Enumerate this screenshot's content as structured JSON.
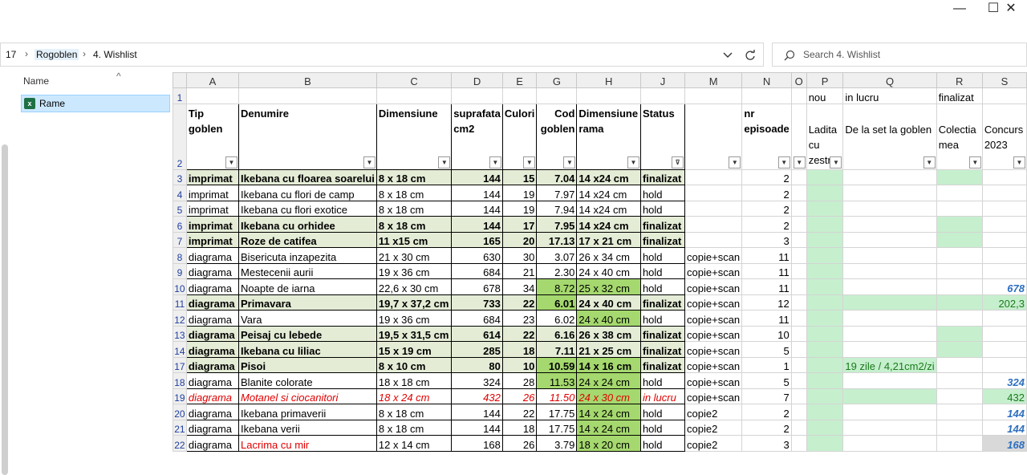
{
  "titlebar": {
    "minimize": "—",
    "maximize": "☐",
    "close": "✕"
  },
  "address": {
    "prev_fragment": "17",
    "crumbs": [
      "Rogoblen",
      "4. Wishlist"
    ],
    "separator": "›",
    "dropdown_icon": "chevron-down",
    "refresh_icon": "refresh"
  },
  "search": {
    "placeholder": "Search 4. Wishlist"
  },
  "nav": {
    "column_label": "Name",
    "sort_glyph": "^",
    "item": "Rame"
  },
  "columns": [
    "A",
    "B",
    "C",
    "D",
    "E",
    "G",
    "H",
    "J",
    "M",
    "N",
    "O",
    "P",
    "Q",
    "R",
    "S"
  ],
  "row1": {
    "P": "nou",
    "Q": "in lucru",
    "R": "finalizat"
  },
  "headers": {
    "A": "Tip goblen",
    "B": "Denumire",
    "C": "Dimensiune",
    "D": "suprafata cm2",
    "E": "Culori",
    "G": "Cod goblen",
    "H": "Dimensiune rama",
    "J": "Status",
    "M": "",
    "N": "nr episoade",
    "O": "",
    "P": "Ladita cu zestre",
    "Q": "De la set la goblen",
    "R": "Colectia mea",
    "S": "Concurs 2023"
  },
  "rows": [
    {
      "n": "3",
      "A": "imprimat",
      "B": "Ikebana cu floarea soarelui",
      "C": "8 x 18 cm",
      "D": "144",
      "E": "15",
      "G": "7.04",
      "H": "14 x24 cm",
      "J": "finalizat",
      "M": "",
      "N": "2",
      "P": "",
      "Q": "",
      "R": "",
      "S": ""
    },
    {
      "n": "4",
      "A": "imprimat",
      "B": "Ikebana cu flori de camp",
      "C": "8 x 18 cm",
      "D": "144",
      "E": "19",
      "G": "7.97",
      "H": "14 x24 cm",
      "J": "hold",
      "M": "",
      "N": "2",
      "P": "",
      "Q": "",
      "R": "",
      "S": ""
    },
    {
      "n": "5",
      "A": "imprimat",
      "B": "Ikebana cu flori exotice",
      "C": "8 x 18 cm",
      "D": "144",
      "E": "19",
      "G": "7.94",
      "H": "14 x24 cm",
      "J": "hold",
      "M": "",
      "N": "2",
      "P": "",
      "Q": "",
      "R": "",
      "S": ""
    },
    {
      "n": "6",
      "A": "imprimat",
      "B": "Ikebana cu orhidee",
      "C": "8 x 18 cm",
      "D": "144",
      "E": "17",
      "G": "7.95",
      "H": "14 x24 cm",
      "J": "finalizat",
      "M": "",
      "N": "2",
      "P": "",
      "Q": "",
      "R": "",
      "S": ""
    },
    {
      "n": "7",
      "A": "imprimat",
      "B": "Roze de catifea",
      "C": "11 x15 cm",
      "D": "165",
      "E": "20",
      "G": "17.13",
      "H": "17 x 21 cm",
      "J": "finalizat",
      "M": "",
      "N": "3",
      "P": "",
      "Q": "",
      "R": "",
      "S": ""
    },
    {
      "n": "8",
      "A": "diagrama",
      "B": "Bisericuta inzapezita",
      "C": "21 x 30 cm",
      "D": "630",
      "E": "30",
      "G": "3.07",
      "H": "26 x 34 cm",
      "J": "hold",
      "M": "copie+scan",
      "N": "11",
      "P": "",
      "Q": "",
      "R": "",
      "S": ""
    },
    {
      "n": "9",
      "A": "diagrama",
      "B": "Mestecenii aurii",
      "C": "19 x 36 cm",
      "D": "684",
      "E": "21",
      "G": "2.30",
      "H": "24 x 40 cm",
      "J": "hold",
      "M": "copie+scan",
      "N": "11",
      "P": "",
      "Q": "",
      "R": "",
      "S": ""
    },
    {
      "n": "10",
      "A": "diagrama",
      "B": "Noapte de iarna",
      "C": "22,6 x 30 cm",
      "D": "678",
      "E": "34",
      "G": "8.72",
      "H": "25 x 32 cm",
      "J": "hold",
      "M": "copie+scan",
      "N": "11",
      "P": "",
      "Q": "",
      "R": "",
      "S": "678"
    },
    {
      "n": "11",
      "A": "diagrama",
      "B": "Primavara",
      "C": "19,7 x 37,2 cm",
      "D": "733",
      "E": "22",
      "G": "6.01",
      "H": "24 x 40 cm",
      "J": "finalizat",
      "M": "copie+scan",
      "N": "12",
      "P": "",
      "Q": "",
      "R": "",
      "S": "202,3"
    },
    {
      "n": "12",
      "A": "diagrama",
      "B": "Vara",
      "C": "19 x 36 cm",
      "D": "684",
      "E": "23",
      "G": "6.02",
      "H": "24 x 40 cm",
      "J": "hold",
      "M": "copie+scan",
      "N": "11",
      "P": "",
      "Q": "",
      "R": "",
      "S": ""
    },
    {
      "n": "13",
      "A": "diagrama",
      "B": "Peisaj cu lebede",
      "C": "19,5 x 31,5 cm",
      "D": "614",
      "E": "22",
      "G": "6.16",
      "H": "26 x 38 cm",
      "J": "finalizat",
      "M": "copie+scan",
      "N": "10",
      "P": "",
      "Q": "",
      "R": "",
      "S": ""
    },
    {
      "n": "14",
      "A": "diagrama",
      "B": "Ikebana cu liliac",
      "C": "15 x 19 cm",
      "D": "285",
      "E": "18",
      "G": "7.11",
      "H": "21 x 25 cm",
      "J": "finalizat",
      "M": "copie+scan",
      "N": "5",
      "P": "",
      "Q": "",
      "R": "",
      "S": ""
    },
    {
      "n": "17",
      "A": "diagrama",
      "B": "Pisoi",
      "C": "8 x 10 cm",
      "D": "80",
      "E": "10",
      "G": "10.59",
      "H": "14 x 16 cm",
      "J": "finalizat",
      "M": "copie+scan",
      "N": "1",
      "P": "",
      "Q": "19 zile / 4,21cm2/zi",
      "R": "",
      "S": ""
    },
    {
      "n": "18",
      "A": "diagrama",
      "B": "Blanite colorate",
      "C": "18 x 18 cm",
      "D": "324",
      "E": "28",
      "G": "11.53",
      "H": "24 x 24 cm",
      "J": "hold",
      "M": "copie+scan",
      "N": "5",
      "P": "",
      "Q": "",
      "R": "",
      "S": "324"
    },
    {
      "n": "19",
      "A": "diagrama",
      "B": "Motanel si ciocanitori",
      "C": "18 x 24 cm",
      "D": "432",
      "E": "26",
      "G": "11.50",
      "H": "24 x 30 cm",
      "J": "in lucru",
      "M": "copie+scan",
      "N": "7",
      "P": "",
      "Q": "",
      "R": "",
      "S": "432"
    },
    {
      "n": "20",
      "A": "diagrama",
      "B": "Ikebana primaverii",
      "C": "8 x 18 cm",
      "D": "144",
      "E": "22",
      "G": "17.75",
      "H": "14 x 24 cm",
      "J": "hold",
      "M": "copie2",
      "N": "2",
      "P": "",
      "Q": "",
      "R": "",
      "S": "144"
    },
    {
      "n": "21",
      "A": "diagrama",
      "B": "Ikebana verii",
      "C": "8 x 18 cm",
      "D": "144",
      "E": "18",
      "G": "17.75",
      "H": "14 x 24 cm",
      "J": "hold",
      "M": "copie2",
      "N": "2",
      "P": "",
      "Q": "",
      "R": "",
      "S": "144"
    },
    {
      "n": "22",
      "A": "diagrama",
      "B": "Lacrima cu mir",
      "C": "12 x 14 cm",
      "D": "168",
      "E": "26",
      "G": "3.79",
      "H": "18 x 20 cm",
      "J": "hold",
      "M": "copie2",
      "N": "3",
      "P": "",
      "Q": "",
      "R": "",
      "S": "168"
    }
  ],
  "colors": {
    "finalized_row": "#e4ecd6",
    "code_highlight": "#a5d86e",
    "mint": "#c6efce",
    "in_progress": "#e00000",
    "contest_value": "#2e6fc0"
  }
}
